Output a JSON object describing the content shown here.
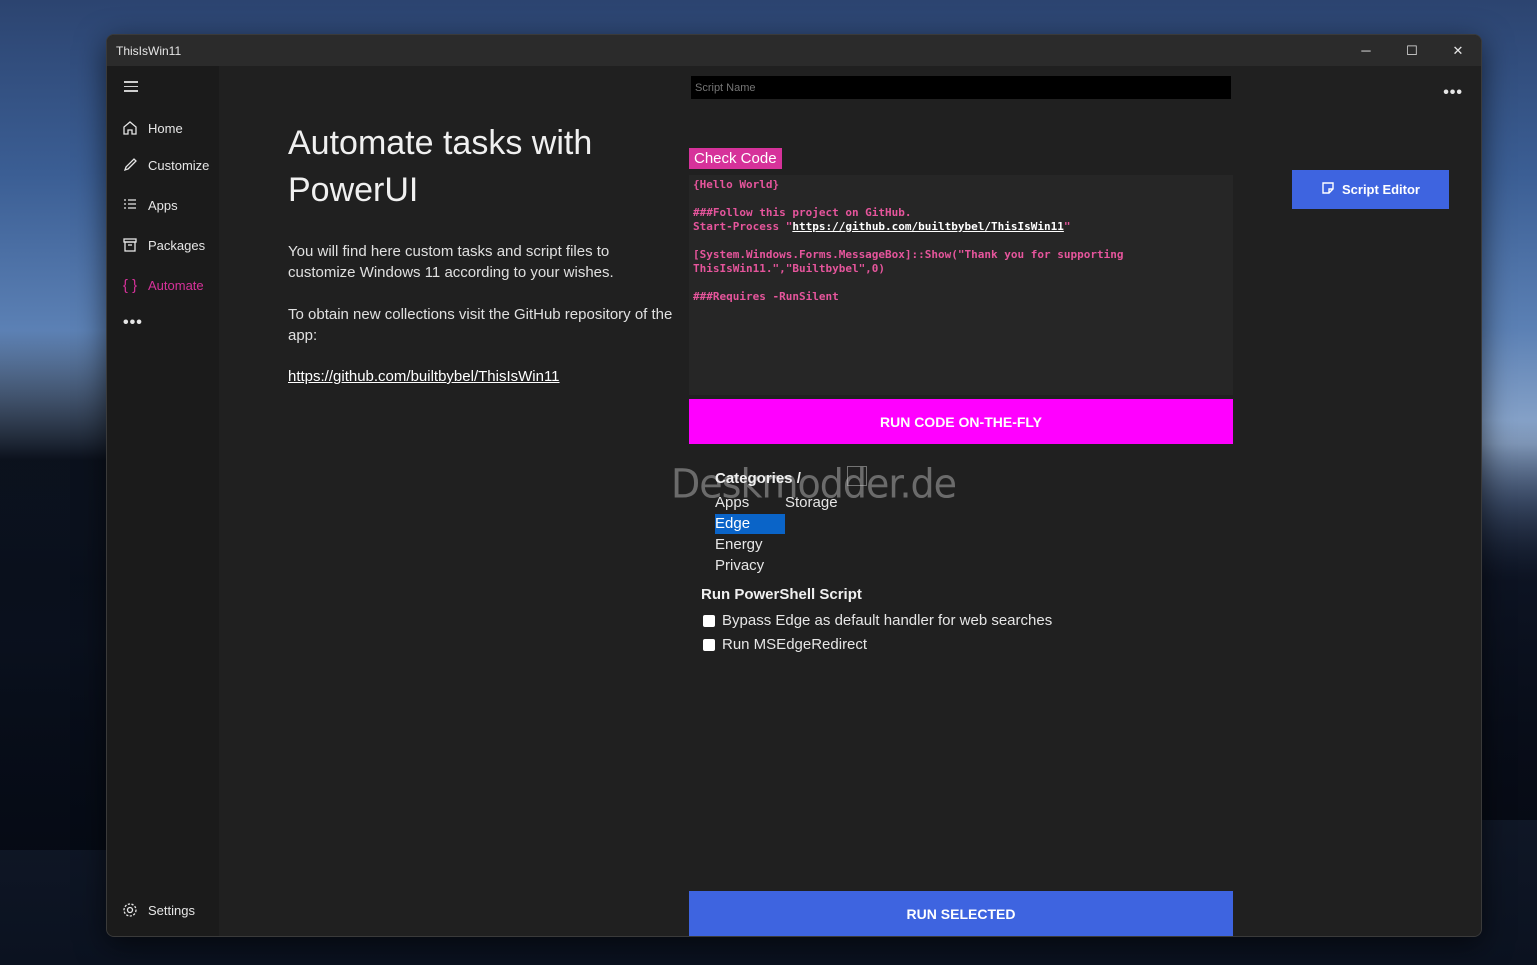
{
  "window": {
    "title": "ThisIsWin11",
    "minimize_glyph": "─",
    "maximize_glyph": "☐",
    "close_glyph": "✕"
  },
  "sidebar": {
    "items": [
      {
        "label": "Home",
        "icon": "home-icon"
      },
      {
        "label": "Customize",
        "icon": "pen-icon"
      },
      {
        "label": "Apps",
        "icon": "list-icon"
      },
      {
        "label": "Packages",
        "icon": "box-icon"
      },
      {
        "label": "Automate",
        "icon": "braces-icon",
        "active": true
      }
    ],
    "more": "•••",
    "settings": {
      "label": "Settings",
      "icon": "gear-icon"
    }
  },
  "main": {
    "heading": "Automate tasks with PowerUI",
    "desc1": "You will find here custom tasks and script files to customize Windows 11 according to your wishes.",
    "desc2": "To obtain new collections visit the GitHub repository of the app:",
    "link": "https://github.com/builtbybel/ThisIsWin11",
    "more": "•••"
  },
  "editor": {
    "script_name_placeholder": "Script Name",
    "check_code": "Check Code",
    "code": {
      "l1": "{Hello World}",
      "l3": "###Follow this project on GitHub.",
      "l4_pre": "Start-Process \"",
      "l4_url": "https://github.com/builtbybel/ThisIsWin11",
      "l4_post": "\"",
      "l6": "[System.Windows.Forms.MessageBox]::Show(\"Thank you for supporting",
      "l7": "ThisIsWin11.\",\"Builtbybel\",0)",
      "l9": "###Requires -RunSilent"
    },
    "run_fly": "RUN CODE ON-THE-FLY",
    "script_editor": "Script Editor"
  },
  "categories": {
    "label": "Categories /",
    "items": [
      "Apps",
      "Storage",
      "Edge",
      "Energy",
      "Privacy"
    ],
    "selected": "Edge"
  },
  "watermark": "Deskmodder.de",
  "powershell": {
    "label": "Run PowerShell Script",
    "options": [
      {
        "label": "Bypass Edge as default handler for web searches",
        "checked": false
      },
      {
        "label": "Run MSEdgeRedirect",
        "checked": false
      }
    ]
  },
  "run_selected": "RUN SELECTED",
  "colors": {
    "accent_pink": "#ff00ff",
    "active_nav": "#d6329a",
    "button_blue": "#3e64e0",
    "selection_blue": "#0a64c8"
  }
}
